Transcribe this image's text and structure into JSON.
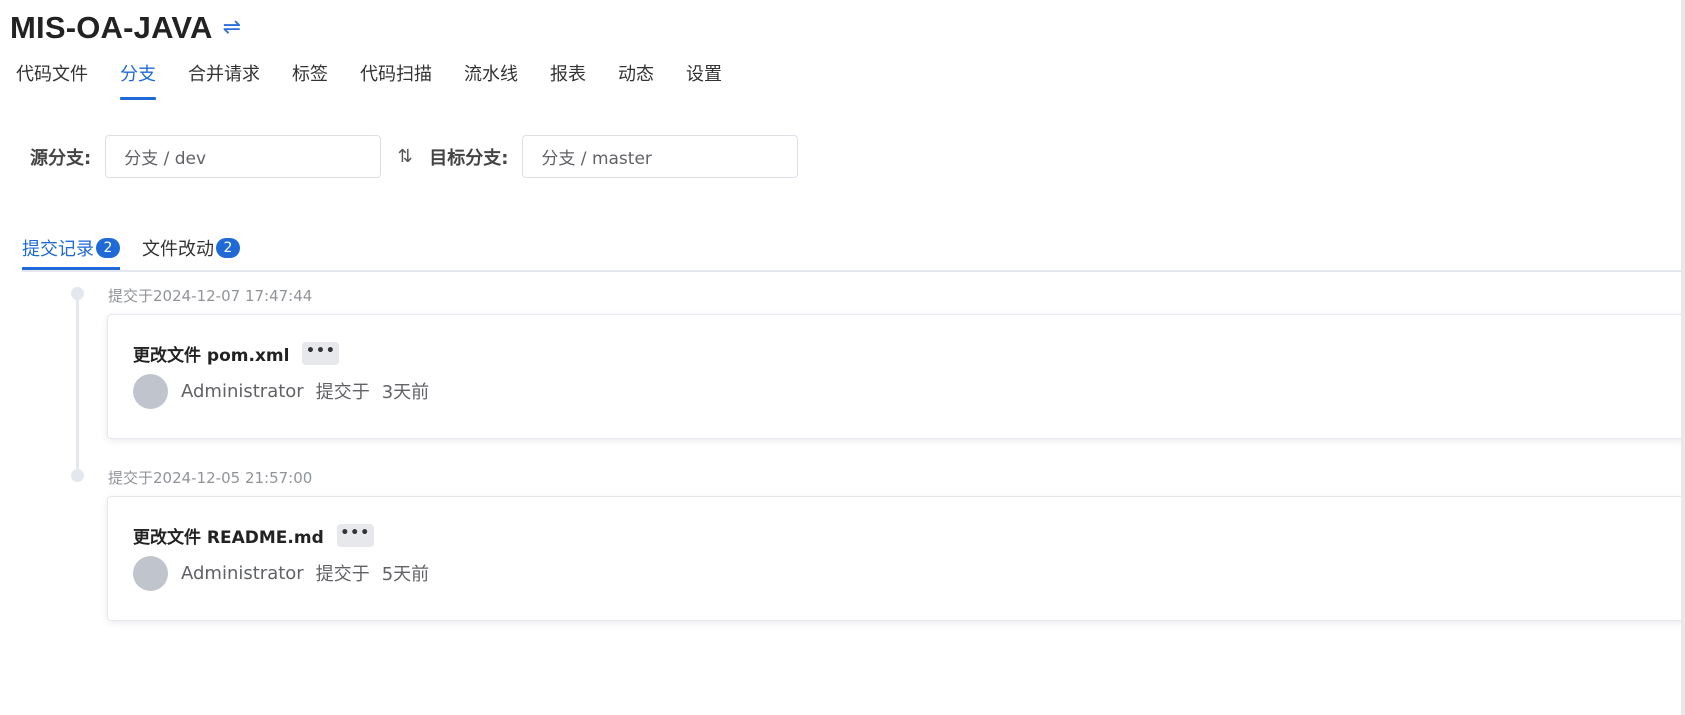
{
  "header": {
    "repo_name": "MIS-OA-JAVA",
    "switch_icon": "swap-horizontal-icon"
  },
  "nav": {
    "tabs": [
      {
        "label": "代码文件"
      },
      {
        "label": "分支"
      },
      {
        "label": "合并请求"
      },
      {
        "label": "标签"
      },
      {
        "label": "代码扫描"
      },
      {
        "label": "流水线"
      },
      {
        "label": "报表"
      },
      {
        "label": "动态"
      },
      {
        "label": "设置"
      }
    ],
    "active_tab": "分支"
  },
  "compare": {
    "source_label": "源分支:",
    "source_value": "分支 / dev",
    "swap_icon": "swap-vertical-icon",
    "target_label": "目标分支:",
    "target_value": "分支 / master"
  },
  "sub_tabs": {
    "items": [
      {
        "label": "提交记录",
        "count": "2"
      },
      {
        "label": "文件改动",
        "count": "2"
      }
    ],
    "active": "提交记录"
  },
  "commits": [
    {
      "timestamp": "提交于2024-12-07 17:47:44",
      "title": "更改文件 pom.xml",
      "more_label": "•••",
      "author": "Administrator",
      "action": "提交于",
      "relative_time": "3天前"
    },
    {
      "timestamp": "提交于2024-12-05 21:57:00",
      "title": "更改文件 README.md",
      "more_label": "•••",
      "author": "Administrator",
      "action": "提交于",
      "relative_time": "5天前"
    }
  ],
  "colors": {
    "accent": "#1f6ad6",
    "timeline": "#e4e7ed",
    "avatar": "#c0c4cc"
  }
}
